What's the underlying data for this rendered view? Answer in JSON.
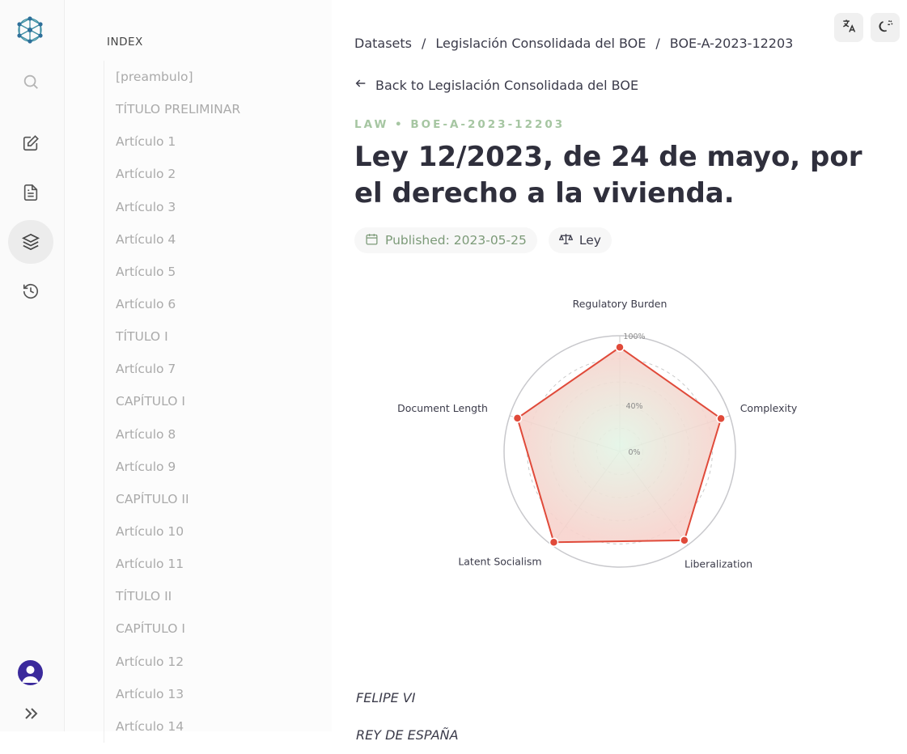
{
  "rail": {
    "icons": [
      "logo-network-icon",
      "search-icon",
      "edit-icon",
      "document-icon",
      "layers-icon",
      "history-icon",
      "user-avatar-icon",
      "chevrons-right-icon"
    ]
  },
  "index": {
    "heading": "INDEX",
    "items": [
      "[preambulo]",
      "TÍTULO PRELIMINAR",
      "Artículo 1",
      "Artículo 2",
      "Artículo 3",
      "Artículo 4",
      "Artículo 5",
      "Artículo 6",
      "TÍTULO I",
      "Artículo 7",
      "CAPÍTULO I",
      "Artículo 8",
      "Artículo 9",
      "CAPÍTULO II",
      "Artículo 10",
      "Artículo 11",
      "TÍTULO II",
      "CAPÍTULO I",
      "Artículo 12",
      "Artículo 13",
      "Artículo 14"
    ]
  },
  "breadcrumb": {
    "items": [
      "Datasets",
      "Legislación Consolidada del BOE",
      "BOE-A-2023-12203"
    ],
    "separator": "/"
  },
  "back_link": "Back to Legislación Consolidada del BOE",
  "kicker": "LAW • BOE-A-2023-12203",
  "title": "Ley 12/2023, de 24 de mayo, por el derecho a la vivienda.",
  "meta": {
    "published": "Published: 2023-05-25",
    "category": "Ley"
  },
  "chart_data": {
    "type": "radar",
    "axes": [
      "Regulatory Burden",
      "Complexity",
      "Liberalization",
      "Latent Socialism",
      "Document Length"
    ],
    "values": [
      0.9,
      0.92,
      0.95,
      0.97,
      0.93
    ],
    "tick_labels": [
      "0%",
      "40%",
      "100%"
    ],
    "color": "#e04a3a"
  },
  "body": [
    "FELIPE VI",
    "REY DE ESPAÑA"
  ],
  "colors": {
    "accent_kicker": "#a6c6a2",
    "published": "#7c9a78",
    "avatar": "#3b2a9c"
  }
}
